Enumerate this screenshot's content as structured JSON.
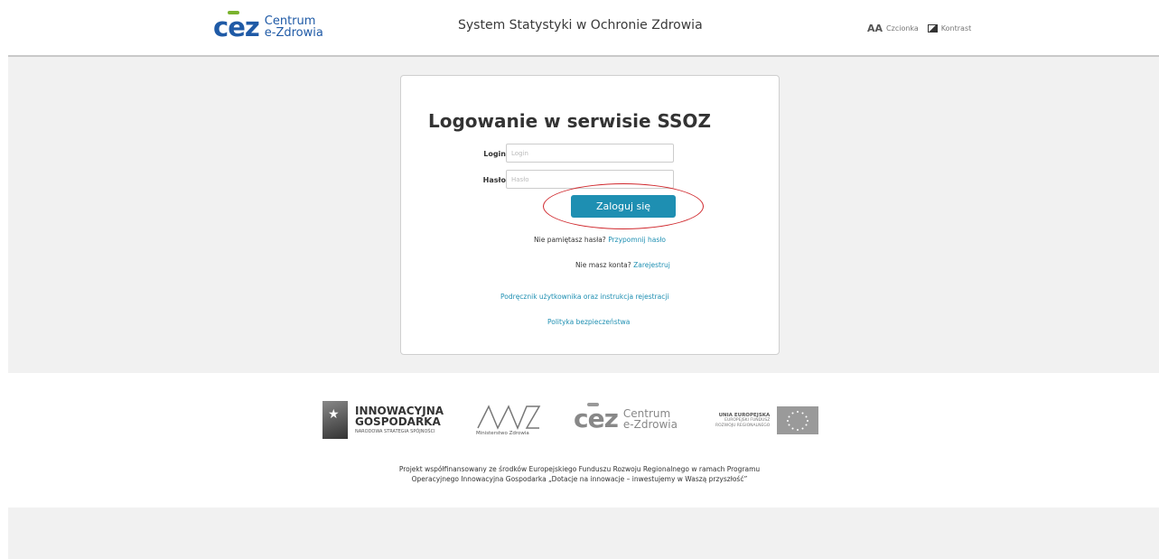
{
  "header": {
    "logo": {
      "mark": "cez",
      "line1": "Centrum",
      "line2": "e-Zdrowia"
    },
    "system_title": "System Statystyki w Ochronie Zdrowia",
    "font_label": "Czcionka",
    "font_icon_glyph": "AA",
    "contrast_label": "Kontrast"
  },
  "login": {
    "title": "Logowanie w serwisie SSOZ",
    "login_label": "Login",
    "login_placeholder": "Login",
    "login_value": "",
    "password_label": "Hasło",
    "password_placeholder": "Hasło",
    "password_value": "",
    "submit_label": "Zaloguj się",
    "forgot_prefix": "Nie pamiętasz hasła?",
    "forgot_link": "Przypomnij hasło",
    "register_prefix": "Nie masz konta?",
    "register_link": "Zarejestruj",
    "manual_link": "Podręcznik użytkownika oraz instrukcja rejestracji",
    "policy_link": "Polityka bezpieczeństwa"
  },
  "footer": {
    "ig_line1": "INNOWACYJNA",
    "ig_line2": "GOSPODARKA",
    "ig_line3": "NARODOWA STRATEGIA SPÓJNOŚCI",
    "mz_label": "Ministerstwo Zdrowia",
    "cez_line1": "Centrum",
    "cez_line2": "e-Zdrowia",
    "ue_line1": "UNIA EUROPEJSKA",
    "ue_line2": "EUROPEJSKI FUNDUSZ",
    "ue_line3": "ROZWOJU REGIONALNEGO",
    "project_line1": "Projekt współfinansowany ze środków Europejskiego Funduszu Rozwoju Regionalnego w ramach Programu",
    "project_line2": "Operacyjnego Innowacyjna Gospodarka „Dotacje na innowacje – inwestujemy w Waszą przyszłość”"
  },
  "colors": {
    "brand_blue": "#1f5aa6",
    "accent_green": "#7ab32e",
    "button": "#1e8fb2",
    "highlight_ring": "#d0282d"
  }
}
